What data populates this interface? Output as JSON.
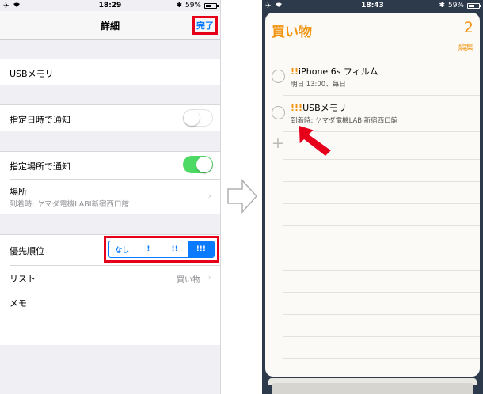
{
  "left": {
    "status": {
      "time": "18:29",
      "battery": "59%",
      "battery_level": 0.59
    },
    "nav": {
      "title": "詳細",
      "done_label": "完了"
    },
    "title_field": {
      "value": "USBメモリ"
    },
    "alarm_date": {
      "label": "指定日時で通知",
      "on": false
    },
    "alarm_location": {
      "label": "指定場所で通知",
      "on": true
    },
    "location": {
      "label": "場所",
      "detail": "到着時: ヤマダ電機LABI新宿西口館"
    },
    "priority": {
      "label": "優先順位",
      "options": [
        "なし",
        "!",
        "!!",
        "!!!"
      ],
      "selected_index": 3
    },
    "list": {
      "label": "リスト",
      "value": "買い物"
    },
    "memo": {
      "label": "メモ"
    }
  },
  "right": {
    "status": {
      "time": "18:43",
      "battery": "59%",
      "battery_level": 0.59
    },
    "list_title": "買い物",
    "count": "2",
    "edit_label": "編集",
    "items": [
      {
        "priority": "!!",
        "title": "iPhone 6s フィルム",
        "subtitle": "明日 13:00、毎日"
      },
      {
        "priority": "!!!",
        "title": "USBメモリ",
        "subtitle": "到着時: ヤマダ電機LABI新宿西口館"
      }
    ]
  },
  "colors": {
    "ios_blue": "#0a7aff",
    "highlight_red": "#e6001a",
    "toggle_green": "#4cd964",
    "reminders_orange": "#f29410"
  }
}
